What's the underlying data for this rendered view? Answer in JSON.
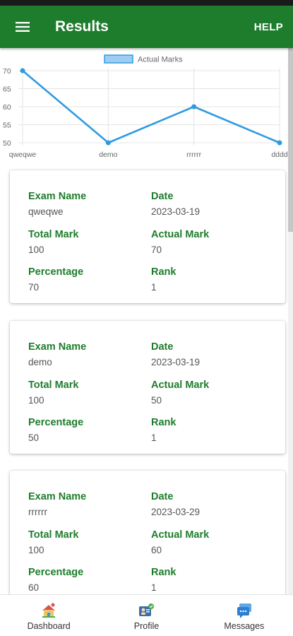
{
  "header": {
    "title": "Results",
    "help_label": "HELP",
    "menu_icon": "menu-icon"
  },
  "chart_data": {
    "type": "line",
    "categories": [
      "qweqwe",
      "demo",
      "rrrrrr",
      "dddd"
    ],
    "series": [
      {
        "name": "Actual Marks",
        "values": [
          70,
          50,
          60,
          50
        ],
        "color": "#2e9be0"
      }
    ],
    "ylim": [
      50,
      70
    ],
    "yticks": [
      50,
      55,
      60,
      65,
      70
    ],
    "legend": "top-center",
    "grid": true
  },
  "labels": {
    "exam_name": "Exam Name",
    "date": "Date",
    "total_mark": "Total Mark",
    "actual_mark": "Actual Mark",
    "percentage": "Percentage",
    "rank": "Rank"
  },
  "results": [
    {
      "exam_name": "qweqwe",
      "date": "2023-03-19",
      "total_mark": "100",
      "actual_mark": "70",
      "percentage": "70",
      "rank": "1"
    },
    {
      "exam_name": "demo",
      "date": "2023-03-19",
      "total_mark": "100",
      "actual_mark": "50",
      "percentage": "50",
      "rank": "1"
    },
    {
      "exam_name": "rrrrrr",
      "date": "2023-03-29",
      "total_mark": "100",
      "actual_mark": "60",
      "percentage": "60",
      "rank": "1"
    }
  ],
  "bottom_nav": [
    {
      "label": "Dashboard",
      "icon": "dashboard-icon"
    },
    {
      "label": "Profile",
      "icon": "profile-icon"
    },
    {
      "label": "Messages",
      "icon": "messages-icon"
    }
  ],
  "colors": {
    "primary": "#1e7d2c",
    "accent": "#2e9be0"
  }
}
